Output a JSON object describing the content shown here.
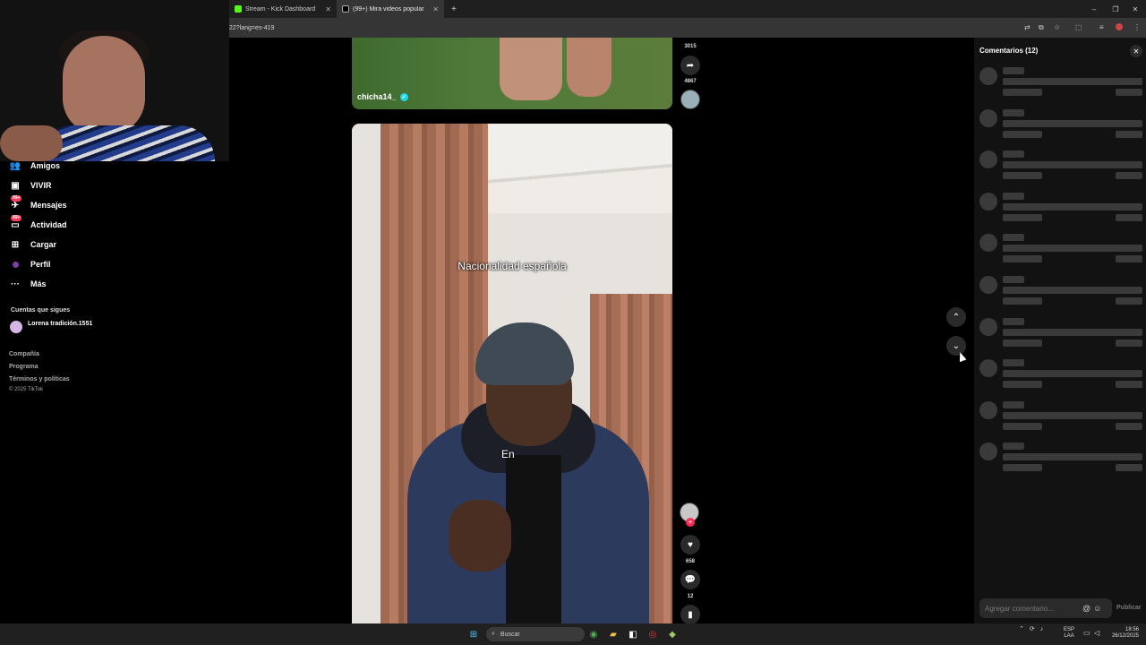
{
  "browser": {
    "tabs": [
      {
        "title": "Stream - Kick Dashboard",
        "icon": "kick-icon",
        "color": "#53fc18"
      },
      {
        "title": "(99+) Mira videos popular...",
        "icon": "tiktok-icon",
        "color": "#ffffff"
      }
    ],
    "new_tab": "+",
    "url": "22?lang=es-419",
    "window_controls": {
      "minimize": "–",
      "maximize": "❐",
      "close": "✕"
    }
  },
  "sidebar": {
    "items": [
      {
        "label": "Amigos",
        "icon": "friends-icon",
        "badge": ""
      },
      {
        "label": "VIVIR",
        "icon": "live-icon",
        "badge": ""
      },
      {
        "label": "Mensajes",
        "icon": "messages-icon",
        "badge": "99+"
      },
      {
        "label": "Actividad",
        "icon": "activity-icon",
        "badge": "99+"
      },
      {
        "label": "Cargar",
        "icon": "upload-icon",
        "badge": ""
      },
      {
        "label": "Perfil",
        "icon": "profile-icon",
        "badge": ""
      },
      {
        "label": "Más",
        "icon": "more-icon",
        "badge": ""
      }
    ],
    "following_title": "Cuentas que sigues",
    "following": [
      {
        "name": "Lorena tradición.1551"
      }
    ],
    "footer": [
      "Compañía",
      "Programa",
      "Términos y políticas",
      "© 2025 TikTok"
    ]
  },
  "feed": {
    "video1": {
      "author": "chicha14_",
      "bookmarks": "3015",
      "shares": "4867"
    },
    "video2": {
      "caption": "Nacionalidad española",
      "subtitle": "En",
      "likes": "658",
      "comments": "12"
    },
    "nav": {
      "up": "up",
      "down": "down"
    }
  },
  "comments": {
    "title": "Comentarios (12)",
    "placeholder": "Agregar comentario...",
    "publish": "Publicar",
    "skeleton_rows": 10
  },
  "taskbar": {
    "search": "Buscar",
    "lang": "ESP",
    "lang2": "LAA",
    "time": "18:56",
    "date": "26/12/2025"
  },
  "colors": {
    "accent": "#fe2c55",
    "verified": "#20d5ec",
    "background": "#000000",
    "panel": "#121212"
  }
}
